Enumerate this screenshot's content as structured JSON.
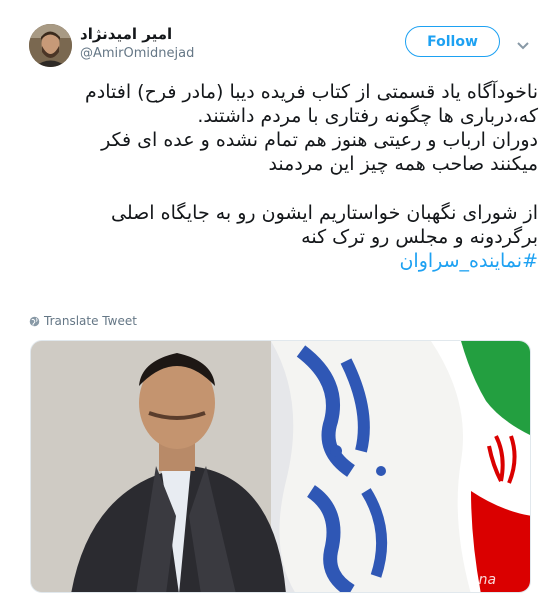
{
  "tweet": {
    "author_name": "امیر امیدنژاد",
    "author_handle": "@AmirOmidnejad",
    "follow_label": "Follow",
    "lines": [
      "ناخودآگاه یاد قسمتی از کتاب فریده دیبا (مادر فرح) افتادم",
      "که،درباری ها چگونه رفتاری با مردم داشتند.",
      "دوران ارباب و رعیتی هنوز هم تمام نشده و عده ای فکر",
      "میکنند صاحب همه چیز این مردمند",
      "",
      "از شورای نگهبان خواستاریم ایشون رو به جایگاه اصلی",
      "برگردونه و مجلس رو ترک کنه"
    ],
    "hashtag": "#نماینده_سراوان",
    "translate_label": "Translate Tweet"
  },
  "colors": {
    "accent": "#1da1f2",
    "text": "#14171a",
    "muted": "#657786"
  },
  "icons": {
    "more": "chevron-down-icon",
    "translate": "globe-icon"
  },
  "media": {
    "watermark": "Ana"
  }
}
